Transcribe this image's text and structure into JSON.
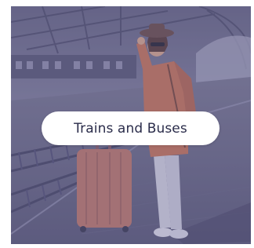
{
  "card": {
    "label": "Trains and Buses",
    "image_subject": "traveler-with-suitcase-on-train-platform",
    "overlay_color": "#5a5a86",
    "label_color": "#2a2c4a",
    "pill_color": "#ffffff"
  }
}
